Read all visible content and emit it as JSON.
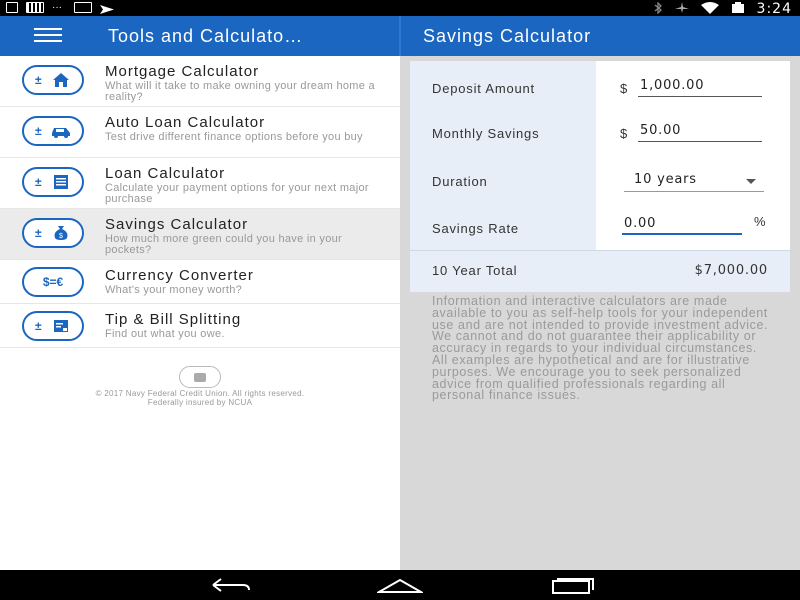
{
  "status_bar": {
    "time": "3:24"
  },
  "app_bar": {
    "left_title": "Tools and Calculato…",
    "right_title": "Savings Calculator"
  },
  "calculators": [
    {
      "title": "Mortgage Calculator",
      "subtitle": "What will it take to make owning your dream home a reality?",
      "icon": "house-icon"
    },
    {
      "title": "Auto Loan Calculator",
      "subtitle": "Test drive different finance options before you buy",
      "icon": "car-icon"
    },
    {
      "title": "Loan Calculator",
      "subtitle": "Calculate your payment options for your next major purchase",
      "icon": "document-icon"
    },
    {
      "title": "Savings Calculator",
      "subtitle": "How much more green could you have in your pockets?",
      "icon": "money-bag-icon"
    },
    {
      "title": "Currency Converter",
      "subtitle": "What's your money worth?",
      "icon": "currency-exchange-icon",
      "symbol": "$=€"
    },
    {
      "title": "Tip & Bill Splitting",
      "subtitle": "Find out what you owe.",
      "icon": "receipt-icon"
    }
  ],
  "footer": {
    "line1": "© 2017 Navy Federal Credit Union. All rights reserved.",
    "line2": "Federally insured by NCUA"
  },
  "savings_form": {
    "deposit_label": "Deposit Amount",
    "currency_symbol": "$",
    "deposit_value": "1,000.00",
    "monthly_label": "Monthly Savings",
    "monthly_value": "50.00",
    "duration_label": "Duration",
    "duration_value": "10 years",
    "rate_label": "Savings Rate",
    "rate_value": "0.00",
    "rate_unit": "%",
    "total_label": "10 Year Total",
    "total_value": "$7,000.00"
  },
  "disclaimer": "Information and interactive calculators are made available to you as self-help tools for your independent use and are not intended to provide investment advice. We cannot and do not guarantee their applicability or accuracy in regards to your individual circumstances. All examples are hypothetical and are for illustrative purposes. We encourage you to seek personalized advice from qualified professionals regarding all personal finance issues.",
  "colors": {
    "brand_blue": "#1a66c0",
    "label_bg": "#e8eef7",
    "selected_bg": "#ebebeb"
  }
}
